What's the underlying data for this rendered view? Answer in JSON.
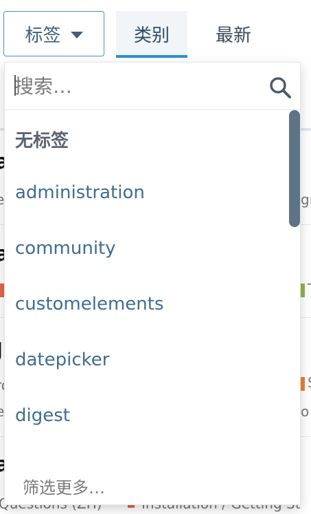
{
  "nav": {
    "tags_label": "标签",
    "tab_categories": "类别",
    "tab_latest": "最新"
  },
  "dropdown": {
    "search_placeholder": "搜索…",
    "items": [
      "无标签",
      "administration",
      "community",
      "customelements",
      "datepicker",
      "digest"
    ],
    "footer": "筛选更多…"
  },
  "background": {
    "row_titles": [
      "a",
      "a",
      "J",
      "a"
    ],
    "row_left_fragments": [
      "e",
      "",
      "ro",
      "e"
    ],
    "row_right_fragments": [
      "gr",
      "T",
      "S",
      "o"
    ],
    "bottom_text_left": "Questions (ZH)",
    "bottom_text_right": "Installation / Getting St"
  },
  "colors": {
    "accent": "#2d8fd0",
    "link": "#3f6c91",
    "scrollbar": "#5f7387",
    "square_orange": "#e5863b",
    "square_green": "#8cb84a",
    "square_red": "#e06a4d"
  }
}
